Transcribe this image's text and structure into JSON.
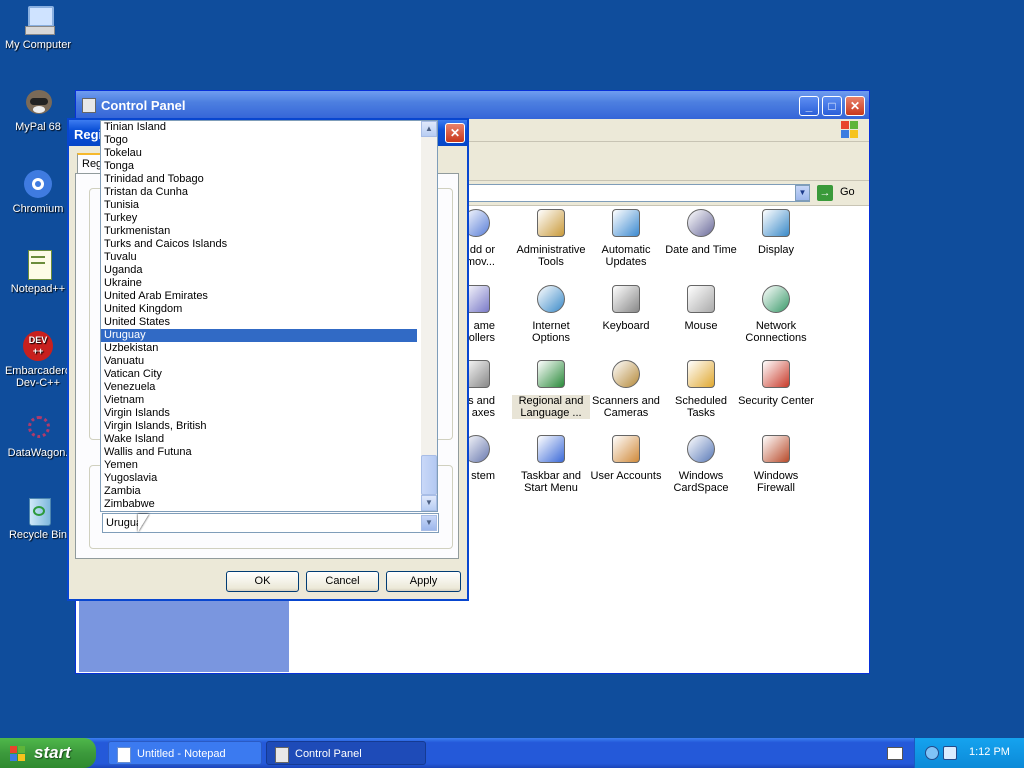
{
  "desktop": {
    "icons": [
      {
        "label": "My Computer",
        "icon": "my-computer-icon"
      },
      {
        "label": "MyPal 68",
        "icon": "mypal-icon"
      },
      {
        "label": "Chromium",
        "icon": "chromium-icon"
      },
      {
        "label": "Notepad++",
        "icon": "notepadpp-icon"
      },
      {
        "label": "Embarcadero Dev-C++",
        "icon": "devcpp-icon"
      },
      {
        "label": "DataWagon.",
        "icon": "datawagon-icon"
      },
      {
        "label": "Recycle Bin",
        "icon": "recycle-bin-icon"
      }
    ]
  },
  "control_panel": {
    "title": "Control Panel",
    "go_label": "Go",
    "items": [
      {
        "label": "Add or Remov...",
        "icon": "add-remove-icon"
      },
      {
        "label": "Administrative Tools",
        "icon": "admin-tools-icon"
      },
      {
        "label": "Automatic Updates",
        "icon": "automatic-updates-icon"
      },
      {
        "label": "Date and Time",
        "icon": "date-time-icon"
      },
      {
        "label": "Display",
        "icon": "display-icon"
      },
      {
        "label": "Game Controllers",
        "icon": "game-controllers-icon"
      },
      {
        "label": "Internet Options",
        "icon": "internet-options-icon"
      },
      {
        "label": "Keyboard",
        "icon": "keyboard-icon"
      },
      {
        "label": "Mouse",
        "icon": "mouse-icon"
      },
      {
        "label": "Network Connections",
        "icon": "network-icon"
      },
      {
        "label": "Printers and Faxes",
        "icon": "printers-icon"
      },
      {
        "label": "Regional and Language ...",
        "icon": "globe-icon"
      },
      {
        "label": "Scanners and Cameras",
        "icon": "scanner-icon"
      },
      {
        "label": "Scheduled Tasks",
        "icon": "scheduled-tasks-icon"
      },
      {
        "label": "Security Center",
        "icon": "security-center-icon"
      },
      {
        "label": "System",
        "icon": "system-icon"
      },
      {
        "label": "Taskbar and Start Menu",
        "icon": "taskbar-icon"
      },
      {
        "label": "User Accounts",
        "icon": "user-accounts-icon"
      },
      {
        "label": "Windows CardSpace",
        "icon": "cardspace-icon"
      },
      {
        "label": "Windows Firewall",
        "icon": "firewall-icon"
      }
    ],
    "partial_labels": {
      "add_line1": "dd or",
      "add_line2": "mov...",
      "game_line1": "ame",
      "game_line2": "trollers",
      "printers_line1": "ers and",
      "printers_line2": "axes",
      "system": "stem"
    }
  },
  "dialog": {
    "title_visible": "Regi",
    "tab_visible": "Reg",
    "dropdown_value": "Urugua",
    "ok_label": "OK",
    "cancel_label": "Cancel",
    "apply_label": "Apply",
    "list": [
      "Tinian Island",
      "Togo",
      "Tokelau",
      "Tonga",
      "Trinidad and Tobago",
      "Tristan da Cunha",
      "Tunisia",
      "Turkey",
      "Turkmenistan",
      "Turks and Caicos Islands",
      "Tuvalu",
      "Uganda",
      "Ukraine",
      "United Arab Emirates",
      "United Kingdom",
      "United States",
      "Uruguay",
      "Uzbekistan",
      "Vanuatu",
      "Vatican City",
      "Venezuela",
      "Vietnam",
      "Virgin Islands",
      "Virgin Islands, British",
      "Wake Island",
      "Wallis and Futuna",
      "Yemen",
      "Yugoslavia",
      "Zambia",
      "Zimbabwe"
    ],
    "selected": "Uruguay"
  },
  "taskbar": {
    "start_label": "start",
    "tasks": [
      {
        "label": "Untitled - Notepad",
        "icon": "notepad-icon"
      },
      {
        "label": "Control Panel",
        "icon": "control-panel-icon"
      }
    ],
    "clock": "1:12 PM"
  },
  "colors": {
    "desktop": "#0f4d9c",
    "selection": "#316ac5",
    "start_green": "#3c9a3c"
  }
}
